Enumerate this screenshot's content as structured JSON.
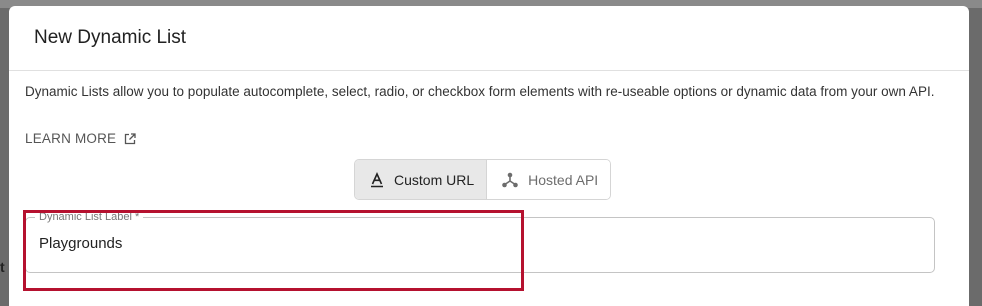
{
  "backdrop": {
    "glyph": "t"
  },
  "dialog": {
    "title": "New Dynamic List",
    "description": "Dynamic Lists allow you to populate autocomplete, select, radio, or checkbox form elements with re-useable options or dynamic data from your own API.",
    "learn_more": "LEARN MORE",
    "toggles": [
      {
        "label": "Custom URL",
        "icon": "text-format-icon",
        "active": true
      },
      {
        "label": "Hosted API",
        "icon": "api-icon",
        "active": false
      }
    ],
    "field": {
      "label": "Dynamic List Label *",
      "value": "Playgrounds"
    }
  },
  "colors": {
    "highlight": "#b5112f",
    "backdrop": "#6b6b6b"
  }
}
